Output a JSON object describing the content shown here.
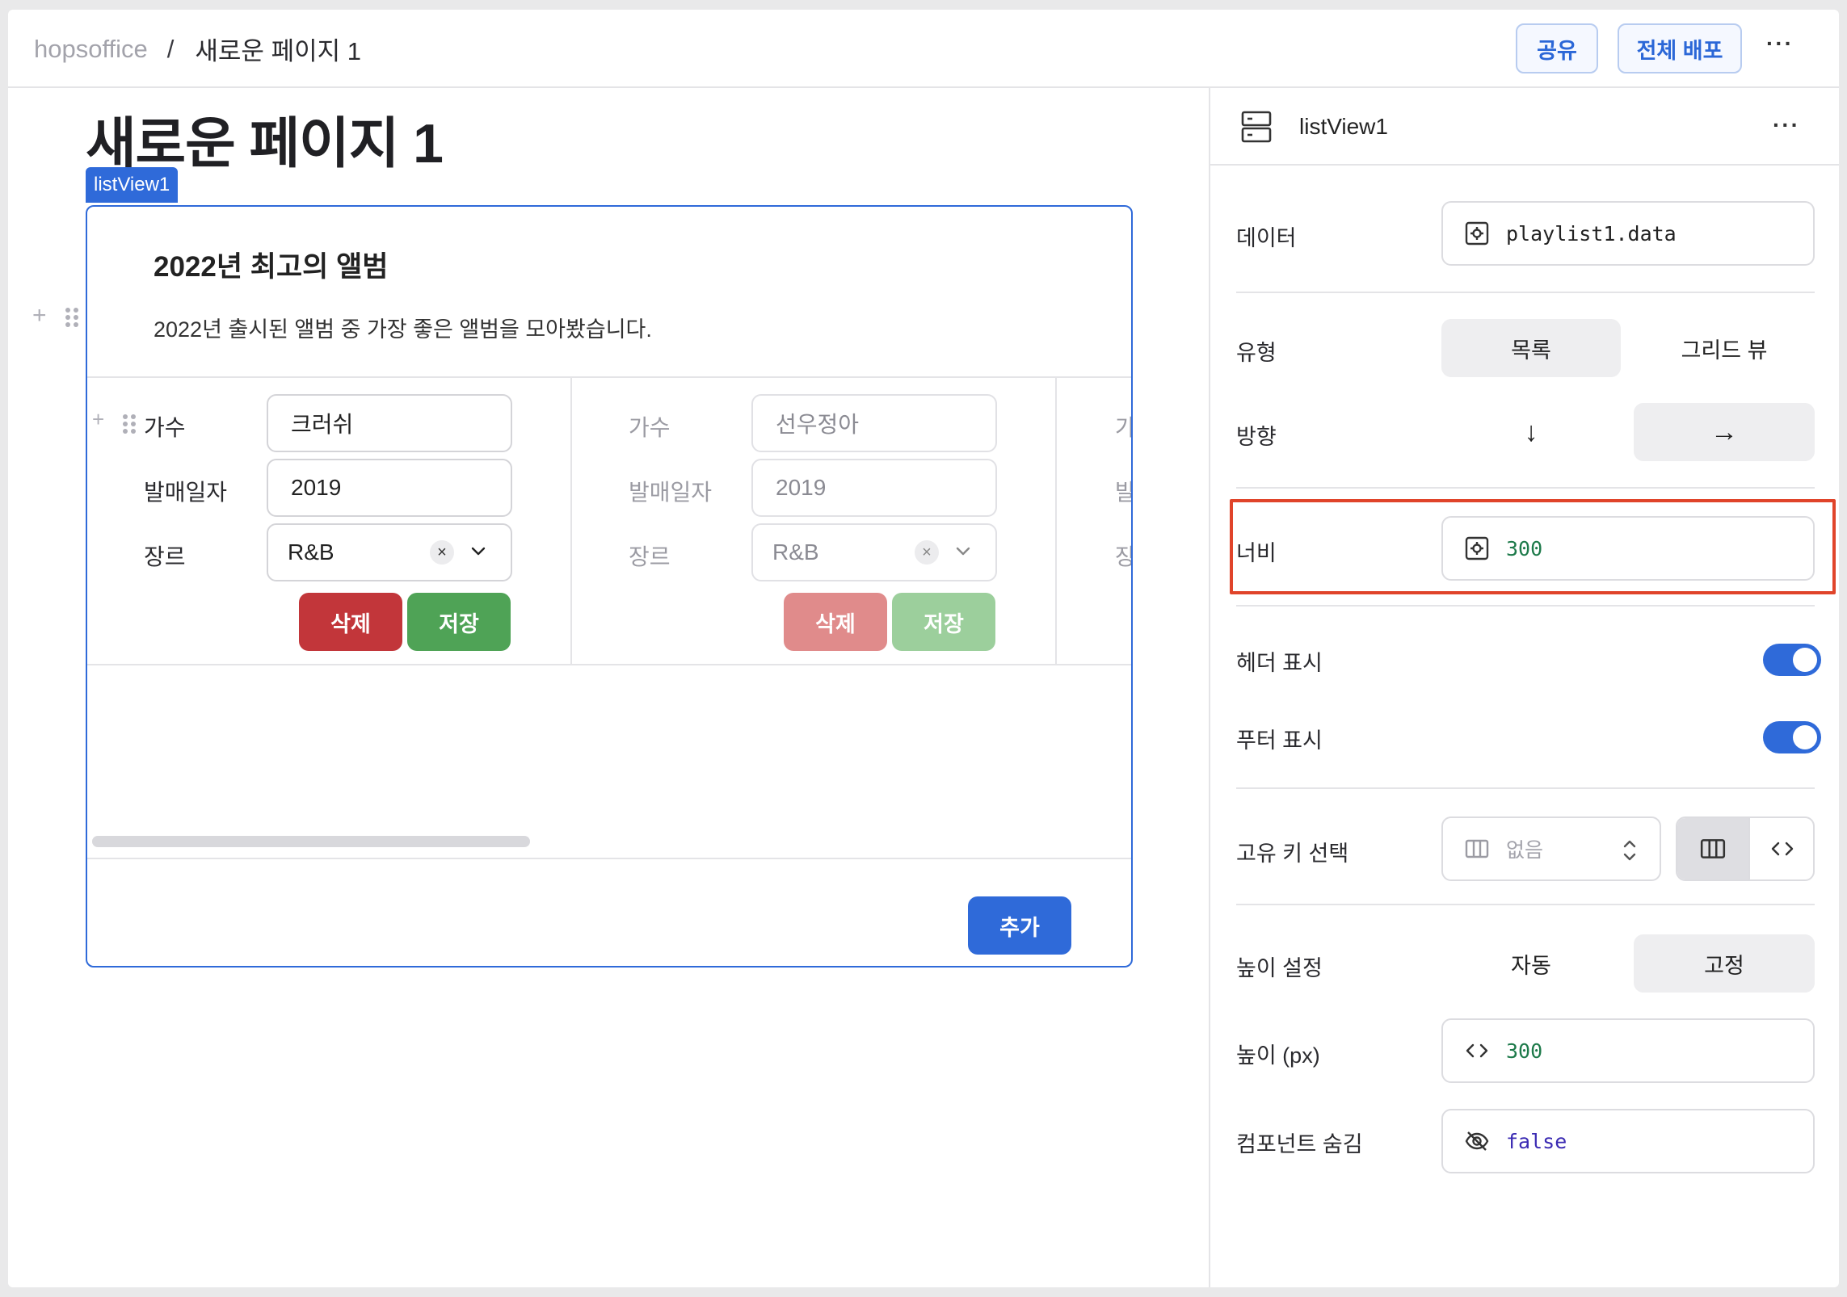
{
  "topbar": {
    "org": "hopsoffice",
    "separator": "/",
    "page": "새로운 페이지 1",
    "share_label": "공유",
    "deploy_label": "전체 배포",
    "more": "···"
  },
  "canvas": {
    "page_title": "새로운 페이지 1",
    "selected_tag": "listView1",
    "listview": {
      "title": "2022년 최고의 앨범",
      "description": "2022년 출시된 앨범 중 가장 좋은 앨범을 모아봤습니다.",
      "labels": {
        "singer": "가수",
        "release": "발매일자",
        "genre": "장르"
      },
      "cards": [
        {
          "singer": "크러쉬",
          "release": "2019",
          "genre": "R&B",
          "delete_label": "삭제",
          "save_label": "저장"
        },
        {
          "singer": "선우정아",
          "release": "2019",
          "genre": "R&B",
          "delete_label": "삭제",
          "save_label": "저장"
        }
      ],
      "partial_labels": {
        "singer": "가",
        "release": "발",
        "genre": "장"
      },
      "add_label": "추가",
      "clear": "×"
    }
  },
  "panel": {
    "component_name": "listView1",
    "more": "···",
    "data_label": "데이터",
    "data_value": "playlist1.data",
    "type_label": "유형",
    "type_options": [
      "목록",
      "그리드 뷰"
    ],
    "type_selected": "목록",
    "direction_label": "방향",
    "direction_options": [
      "↓",
      "→"
    ],
    "direction_selected": "→",
    "width_label": "너비",
    "width_value": "300",
    "header_label": "헤더 표시",
    "header_on": true,
    "footer_label": "푸터 표시",
    "footer_on": true,
    "key_label": "고유 키 선택",
    "key_placeholder": "없음",
    "height_mode_label": "높이 설정",
    "height_mode_options": [
      "자동",
      "고정"
    ],
    "height_mode_selected": "고정",
    "height_label": "높이 (px)",
    "height_value": "300",
    "hidden_label": "컴포넌트 숨김",
    "hidden_value": "false"
  },
  "colors": {
    "accent": "#2f6ad9",
    "highlight": "#e0442a",
    "delete": "#c2363a",
    "save": "#4fa356"
  }
}
